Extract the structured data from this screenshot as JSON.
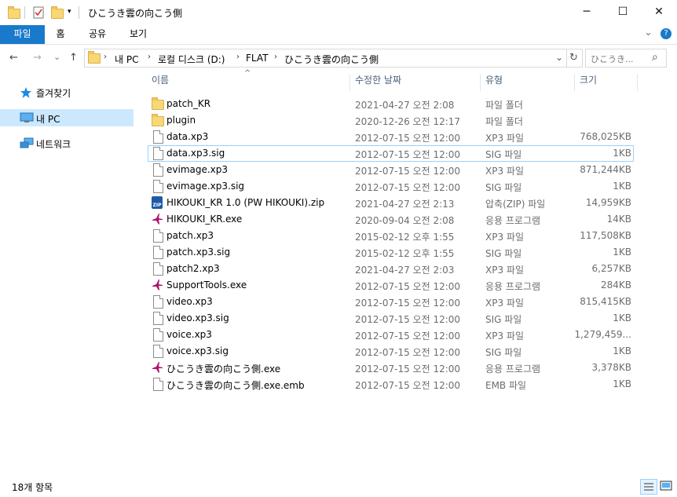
{
  "window": {
    "title": "ひこうき雲の向こう側",
    "min_icon": "─",
    "max_icon": "☐",
    "close_icon": "✕"
  },
  "ribbon": {
    "tabs": [
      {
        "label": "파일",
        "active": true
      },
      {
        "label": "홈",
        "active": false
      },
      {
        "label": "공유",
        "active": false
      },
      {
        "label": "보기",
        "active": false
      }
    ],
    "expand_icon": "⌄",
    "help_icon": "?"
  },
  "nav": {
    "back": "←",
    "forward": "→",
    "recent": "⌄",
    "up": "↑",
    "breadcrumb": [
      "내 PC",
      "로컬 디스크 (D:)",
      "FLAT",
      "ひこうき雲の向こう側"
    ],
    "dropdown": "⌄",
    "refresh": "↻",
    "search_placeholder": "ひこうき...",
    "search_icon": "⌕"
  },
  "sidebar": {
    "items": [
      {
        "label": "즐겨찾기",
        "icon": "star-icon"
      },
      {
        "label": "내 PC",
        "icon": "computer-icon",
        "selected": true
      },
      {
        "label": "네트워크",
        "icon": "network-icon"
      }
    ]
  },
  "columns": {
    "name": "이름",
    "date": "수정한 날짜",
    "type": "유형",
    "size": "크기",
    "sort_indicator": "^"
  },
  "files": [
    {
      "name": "patch_KR",
      "date": "2021-04-27 오전 2:08",
      "type": "파일 폴더",
      "size": "",
      "icon": "folder"
    },
    {
      "name": "plugin",
      "date": "2020-12-26 오전 12:17",
      "type": "파일 폴더",
      "size": "",
      "icon": "folder"
    },
    {
      "name": "data.xp3",
      "date": "2012-07-15 오전 12:00",
      "type": "XP3 파일",
      "size": "768,025KB",
      "icon": "file"
    },
    {
      "name": "data.xp3.sig",
      "date": "2012-07-15 오전 12:00",
      "type": "SIG 파일",
      "size": "1KB",
      "icon": "file",
      "focused": true
    },
    {
      "name": "evimage.xp3",
      "date": "2012-07-15 오전 12:00",
      "type": "XP3 파일",
      "size": "871,244KB",
      "icon": "file"
    },
    {
      "name": "evimage.xp3.sig",
      "date": "2012-07-15 오전 12:00",
      "type": "SIG 파일",
      "size": "1KB",
      "icon": "file"
    },
    {
      "name": "HIKOUKI_KR 1.0 (PW HIKOUKI).zip",
      "date": "2021-04-27 오전 2:13",
      "type": "압축(ZIP) 파일",
      "size": "14,959KB",
      "icon": "zip"
    },
    {
      "name": "HIKOUKI_KR.exe",
      "date": "2020-09-04 오전 2:08",
      "type": "응용 프로그램",
      "size": "14KB",
      "icon": "exe"
    },
    {
      "name": "patch.xp3",
      "date": "2015-02-12 오후 1:55",
      "type": "XP3 파일",
      "size": "117,508KB",
      "icon": "file"
    },
    {
      "name": "patch.xp3.sig",
      "date": "2015-02-12 오후 1:55",
      "type": "SIG 파일",
      "size": "1KB",
      "icon": "file"
    },
    {
      "name": "patch2.xp3",
      "date": "2021-04-27 오전 2:03",
      "type": "XP3 파일",
      "size": "6,257KB",
      "icon": "file"
    },
    {
      "name": "SupportTools.exe",
      "date": "2012-07-15 오전 12:00",
      "type": "응용 프로그램",
      "size": "284KB",
      "icon": "exe"
    },
    {
      "name": "video.xp3",
      "date": "2012-07-15 오전 12:00",
      "type": "XP3 파일",
      "size": "815,415KB",
      "icon": "file"
    },
    {
      "name": "video.xp3.sig",
      "date": "2012-07-15 오전 12:00",
      "type": "SIG 파일",
      "size": "1KB",
      "icon": "file"
    },
    {
      "name": "voice.xp3",
      "date": "2012-07-15 오전 12:00",
      "type": "XP3 파일",
      "size": "1,279,459...",
      "icon": "file"
    },
    {
      "name": "voice.xp3.sig",
      "date": "2012-07-15 오전 12:00",
      "type": "SIG 파일",
      "size": "1KB",
      "icon": "file"
    },
    {
      "name": "ひこうき雲の向こう側.exe",
      "date": "2012-07-15 오전 12:00",
      "type": "응용 프로그램",
      "size": "3,378KB",
      "icon": "exe"
    },
    {
      "name": "ひこうき雲の向こう側.exe.emb",
      "date": "2012-07-15 오전 12:00",
      "type": "EMB 파일",
      "size": "1KB",
      "icon": "file"
    }
  ],
  "status": {
    "count": "18개 항목"
  },
  "colors": {
    "accent": "#1979ca",
    "selection": "#cce8ff",
    "focus": "#99d1ff",
    "exe_icon": "#b0126a"
  }
}
